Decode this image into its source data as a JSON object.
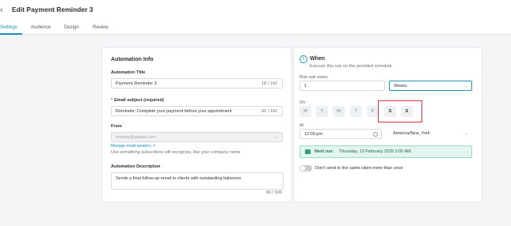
{
  "header": {
    "title": "Edit Payment Reminder 3"
  },
  "tabs": [
    {
      "label": "Settings",
      "active": true
    },
    {
      "label": "Audience"
    },
    {
      "label": "Design"
    },
    {
      "label": "Review"
    }
  ],
  "automation_info": {
    "section_title": "Automation Info",
    "title_label": "Automation Title",
    "title_value": "Payment Reminder 3",
    "title_counter": "18 / 142",
    "subject_label": "Email subject (required)",
    "subject_value": "Reminder: Complete your payment before your appointment",
    "subject_counter": "65 / 142",
    "from_label": "From",
    "from_value": "noreply@qabau.com",
    "manage_link": "Manage email senders",
    "from_hint": "Use something subscribers will recognize, like your company name",
    "description_label": "Automation Description",
    "description_value": "Sends a final follow-up email to clients with outstanding balances",
    "description_counter": "66 / 600"
  },
  "when": {
    "step_number": "1",
    "title": "When",
    "subtitle": "Execute this rule on the provided schedule",
    "run_every_label": "Run rule every",
    "run_every_value": "1",
    "unit_value": "Weeks",
    "on_label": "On",
    "days": [
      {
        "label": "M",
        "selected": false
      },
      {
        "label": "T",
        "selected": false
      },
      {
        "label": "W",
        "selected": false
      },
      {
        "label": "T",
        "selected": false
      },
      {
        "label": "F",
        "selected": false
      },
      {
        "label": "S",
        "selected": true
      },
      {
        "label": "S",
        "selected": true
      }
    ],
    "at_label": "At",
    "time_value": "12:00 pm",
    "timezone_value": "America/New_York",
    "next_run_label": "Next run:",
    "next_run_value": "Thursday, 13 February 2025 3:00 AM",
    "toggle_label": "Don't send to the same client more than once",
    "toggle_on": false
  },
  "colors": {
    "accent": "#1d8fb5",
    "highlight": "#d9363e",
    "success_bg": "#e2f5ef"
  }
}
